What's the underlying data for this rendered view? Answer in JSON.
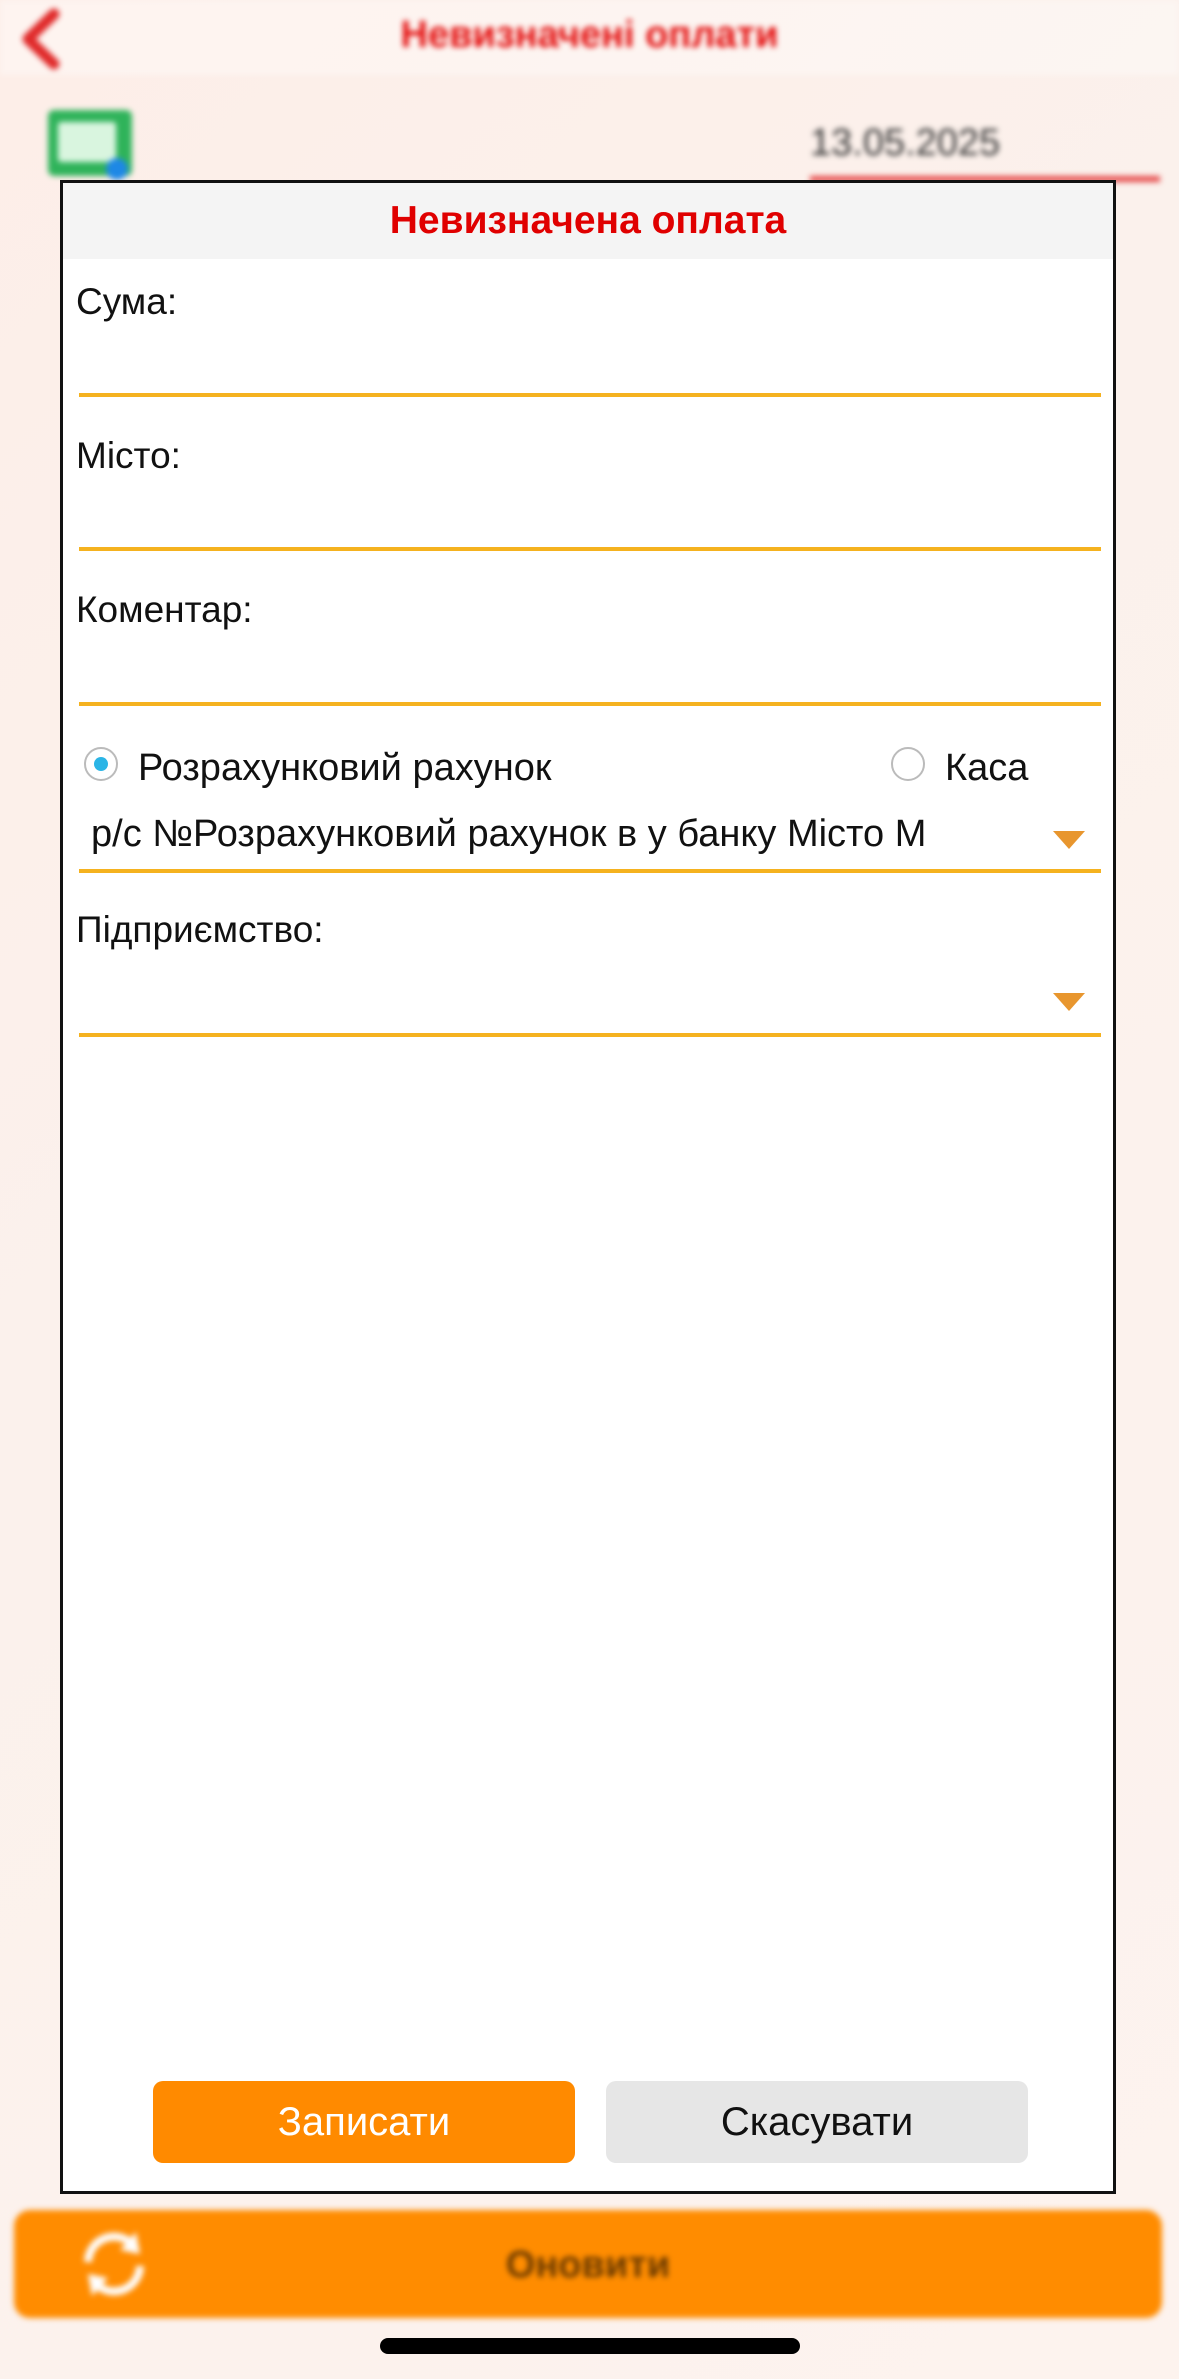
{
  "app": {
    "title": "Невизначені оплати",
    "date": "13.05.2025",
    "refresh_label": "Оновити"
  },
  "dialog": {
    "title": "Невизначена оплата",
    "fields": {
      "sum_label": "Сума:",
      "sum_value": "",
      "city_label": "Місто:",
      "city_value": "",
      "comment_label": "Коментар:",
      "comment_value": ""
    },
    "payment_type": {
      "options": [
        "Розрахунковий рахунок",
        "Каса"
      ],
      "selected": "Розрахунковий рахунок"
    },
    "account_select_value": "р/с №Розрахунковий рахунок в у банку Місто М",
    "enterprise_label": "Підприємство:",
    "enterprise_value": "",
    "save_label": "Записати",
    "cancel_label": "Скасувати"
  },
  "colors": {
    "accent_orange": "#ff8a00",
    "title_red": "#e00000",
    "underline_yellow": "#f5b21f",
    "radio_blue": "#2bb5e6"
  },
  "icons": [
    "chevron-left-icon",
    "excel-export-icon",
    "refresh-icon",
    "dropdown-arrow-icon"
  ]
}
